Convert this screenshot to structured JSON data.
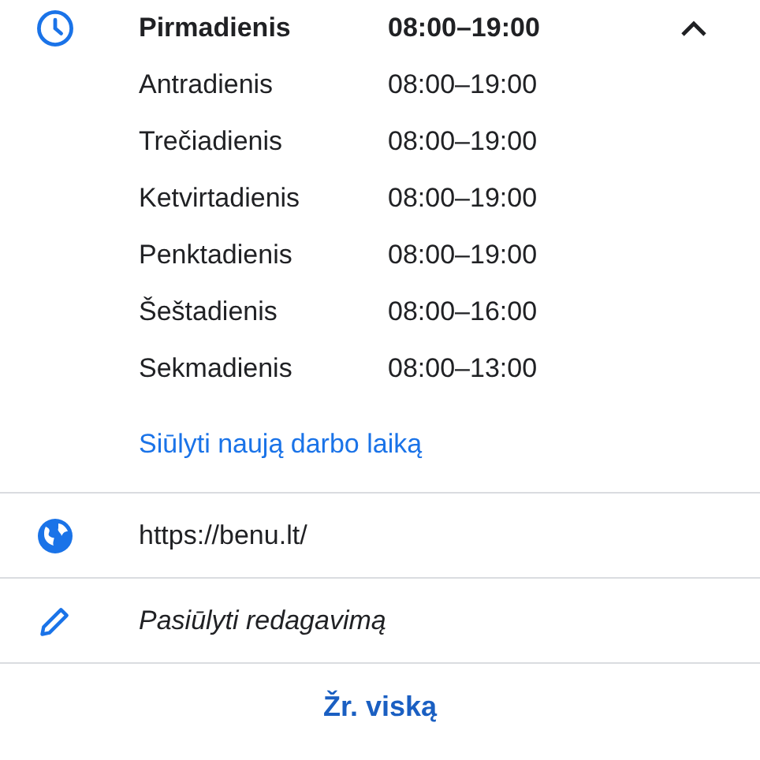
{
  "hours": {
    "expanded": true,
    "days": [
      {
        "day": "Pirmadienis",
        "time": "08:00–19:00",
        "today": true
      },
      {
        "day": "Antradienis",
        "time": "08:00–19:00",
        "today": false
      },
      {
        "day": "Trečiadienis",
        "time": "08:00–19:00",
        "today": false
      },
      {
        "day": "Ketvirtadienis",
        "time": "08:00–19:00",
        "today": false
      },
      {
        "day": "Penktadienis",
        "time": "08:00–19:00",
        "today": false
      },
      {
        "day": "Šeštadienis",
        "time": "08:00–16:00",
        "today": false
      },
      {
        "day": "Sekmadienis",
        "time": "08:00–13:00",
        "today": false
      }
    ],
    "suggest_link": "Siūlyti naują darbo laiką"
  },
  "website": "https://benu.lt/",
  "suggest_edit": "Pasiūlyti redagavimą",
  "see_all": "Žr. viską"
}
